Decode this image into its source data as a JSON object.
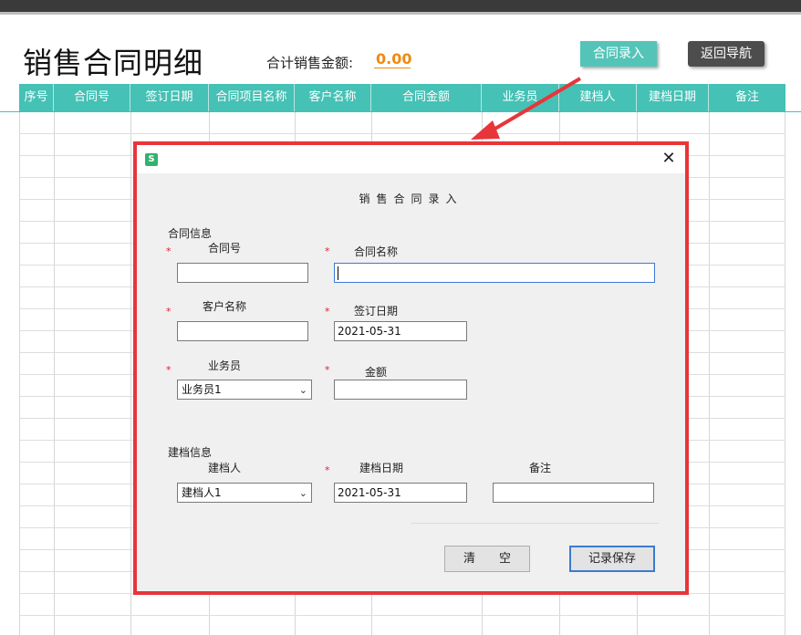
{
  "page": {
    "title": "销售合同明细",
    "total_label": "合计销售金额:",
    "total_value": "0.00",
    "entry_button": "合同录入",
    "back_button": "返回导航"
  },
  "table": {
    "columns": [
      "序号",
      "合同号",
      "签订日期",
      "合同项目名称",
      "客户名称",
      "合同金额",
      "业务员",
      "建档人",
      "建档日期",
      "备注"
    ]
  },
  "dialog": {
    "heading": "销售合同录入",
    "section_contract": "合同信息",
    "section_archive": "建档信息",
    "required_mark": "*",
    "fields": {
      "contract_no": {
        "label": "合同号",
        "value": ""
      },
      "contract_name": {
        "label": "合同名称",
        "value": ""
      },
      "customer": {
        "label": "客户名称",
        "value": ""
      },
      "sign_date": {
        "label": "签订日期",
        "value": "2021-05-31"
      },
      "salesperson": {
        "label": "业务员",
        "value": "业务员1"
      },
      "amount": {
        "label": "金额",
        "value": ""
      },
      "archiver": {
        "label": "建档人",
        "value": "建档人1"
      },
      "archive_date": {
        "label": "建档日期",
        "value": "2021-05-31"
      },
      "remark": {
        "label": "备注",
        "value": ""
      }
    },
    "clear_button": "清　　空",
    "save_button": "记录保存",
    "icon": "app-logo-icon"
  },
  "colors": {
    "header_teal": "#45c1b5",
    "highlight_red": "#e8353a",
    "total_orange": "#ee8a12"
  }
}
